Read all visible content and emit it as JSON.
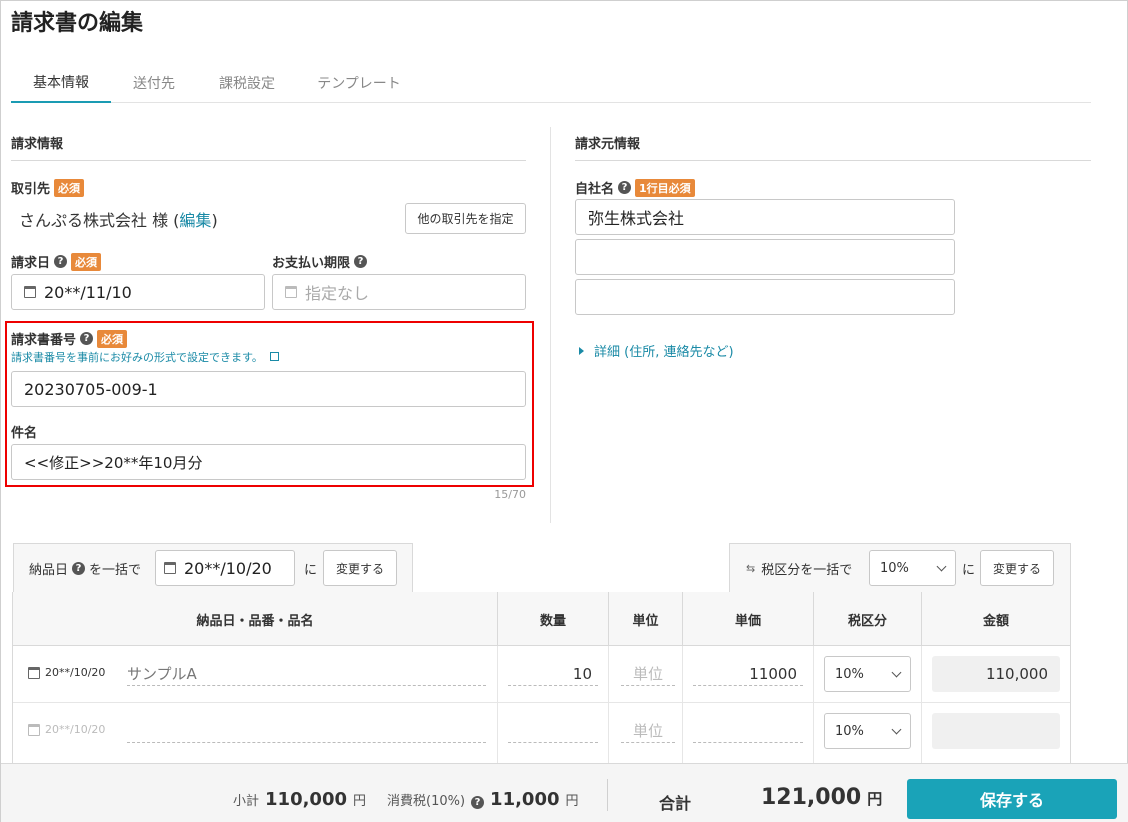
{
  "page": {
    "title": "請求書の編集"
  },
  "tabs": [
    {
      "label": "基本情報"
    },
    {
      "label": "送付先"
    },
    {
      "label": "課税設定"
    },
    {
      "label": "テンプレート"
    }
  ],
  "billing": {
    "section_title": "請求情報",
    "client_label": "取引先",
    "required": "必須",
    "client_name": "さんぷる株式会社 様 (",
    "client_edit": "編集",
    "client_close": ")",
    "other_client_button": "他の取引先を指定",
    "invoice_date_label": "請求日",
    "invoice_date_value": "20**/11/10",
    "due_label": "お支払い期限",
    "due_placeholder": "指定なし",
    "number_label": "請求書番号",
    "number_hint": "請求書番号を事前にお好みの形式で設定できます。",
    "number_value": "20230705-009-1",
    "subject_label": "件名",
    "subject_value": "<<修正>>20**年10月分",
    "subject_count": "15/70"
  },
  "issuer": {
    "section_title": "請求元情報",
    "company_label": "自社名",
    "company_required": "1行目必須",
    "company_line1": "弥生株式会社",
    "company_line2": "",
    "company_line3": "",
    "details_link": "詳細 (住所, 連絡先など)"
  },
  "bulk": {
    "delivery_label": "納品日",
    "batch_text": "を一括で",
    "delivery_date": "20**/10/20",
    "ni": "に",
    "change_button": "変更する",
    "tax_label": "税区分を一括で",
    "tax_value": "10%",
    "ni2": "に",
    "change_button2": "変更する"
  },
  "table": {
    "headers": [
      "納品日・品番・品名",
      "数量",
      "単位",
      "単価",
      "税区分",
      "金額"
    ],
    "rows": [
      {
        "date": "20**/10/20",
        "name": "サンプルA",
        "qty": "10",
        "unit": "単位",
        "price": "11000",
        "tax": "10%",
        "amount": "110,000"
      },
      {
        "date": "20**/10/20",
        "name": "",
        "qty": "",
        "unit": "単位",
        "price": "",
        "tax": "10%",
        "amount": ""
      }
    ]
  },
  "footer": {
    "subtotal_label": "小計",
    "subtotal_value": "110,000",
    "yen": "円",
    "tax_label": "消費税(10%)",
    "tax_value": "11,000",
    "total_label": "合計",
    "total_value": "121,000",
    "save_button": "保存する"
  }
}
